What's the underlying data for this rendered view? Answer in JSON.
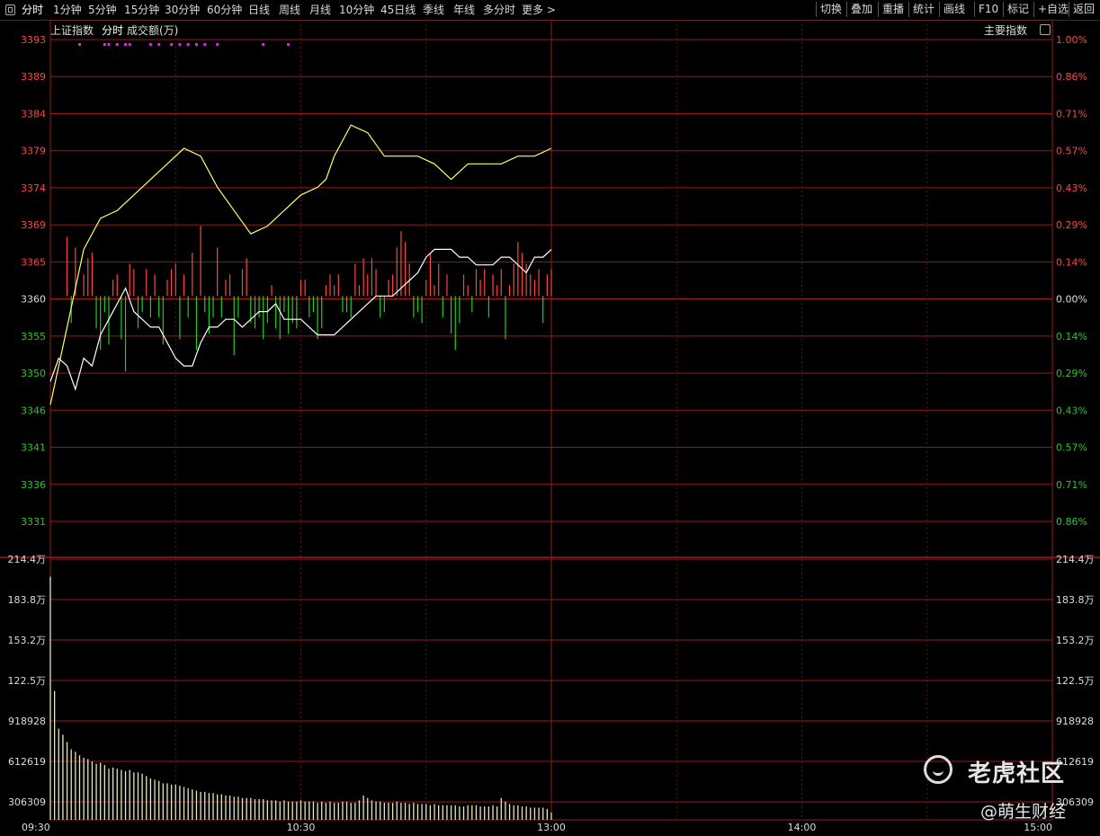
{
  "toolbar": {
    "left_items": [
      "分时",
      "1分钟",
      "5分钟",
      "15分钟",
      "30分钟",
      "60分钟",
      "日线",
      "周线",
      "月线",
      "10分钟",
      "45日线",
      "季线",
      "年线",
      "多分时",
      "更多 >"
    ],
    "right_items": [
      "切换",
      "叠加",
      "重播",
      "统计",
      "画线",
      "F10",
      "标记",
      "+自选",
      "返回"
    ],
    "active": "分时"
  },
  "header": {
    "index_name": "上证指数",
    "mode": "分时",
    "indicator": "成交额(万)",
    "right_label": "主要指数"
  },
  "colors": {
    "background": "#000000",
    "grid": "#9a1a1a",
    "up": "#ff4444",
    "down": "#22cc22",
    "price_line": "#ffffff",
    "avg_line": "#ffff66",
    "volume_bar": "#e8e8c0",
    "marker": "#cc33cc"
  },
  "chart_data": [
    {
      "type": "line",
      "title": "上证指数 分时",
      "y_ticks_left": [
        "3393",
        "3389",
        "3384",
        "3379",
        "3374",
        "3369",
        "3365",
        "3360",
        "3355",
        "3350",
        "3346",
        "3341",
        "3336",
        "3331"
      ],
      "y_ticks_right": [
        "1.00%",
        "0.86%",
        "0.71%",
        "0.57%",
        "0.43%",
        "0.29%",
        "0.14%",
        "0.00%",
        "0.14%",
        "0.29%",
        "0.43%",
        "0.57%",
        "0.71%",
        "0.86%"
      ],
      "ylim": [
        3331,
        3393
      ],
      "baseline": 3360,
      "x_ticks": [
        "09:30",
        "10:30",
        "13:00",
        "14:00",
        "15:00"
      ],
      "x_range_minutes": [
        0,
        240
      ],
      "series": [
        {
          "name": "price",
          "x": [
            0,
            2,
            4,
            6,
            8,
            10,
            12,
            14,
            16,
            18,
            20,
            22,
            24,
            26,
            28,
            30,
            32,
            34,
            36,
            38,
            40,
            42,
            44,
            46,
            48,
            50,
            52,
            54,
            56,
            58,
            60,
            62,
            64,
            66,
            68,
            70,
            72,
            74,
            76,
            78,
            80,
            82,
            84,
            86,
            88,
            90,
            92,
            94,
            96,
            98,
            100,
            102,
            104,
            106,
            108,
            110,
            112,
            114,
            116,
            118,
            120
          ],
          "y": [
            3349,
            3352,
            3351,
            3348,
            3352,
            3351,
            3355,
            3357,
            3359,
            3361,
            3358,
            3357,
            3356,
            3356,
            3354,
            3352,
            3351,
            3351,
            3354,
            3356,
            3356,
            3357,
            3357,
            3356,
            3357,
            3358,
            3358,
            3359,
            3357,
            3357,
            3357,
            3356,
            3355,
            3355,
            3355,
            3356,
            3357,
            3358,
            3359,
            3360,
            3360,
            3360,
            3361,
            3362,
            3363,
            3365,
            3366,
            3366,
            3366,
            3365,
            3365,
            3364,
            3364,
            3364,
            3365,
            3365,
            3364,
            3363,
            3365,
            3365,
            3366
          ]
        },
        {
          "name": "average",
          "x": [
            0,
            4,
            8,
            12,
            16,
            20,
            24,
            28,
            32,
            36,
            40,
            44,
            48,
            52,
            56,
            60,
            64,
            66,
            68,
            72,
            76,
            80,
            84,
            88,
            92,
            96,
            100,
            104,
            108,
            112,
            116,
            120
          ],
          "y": [
            3346,
            3356,
            3366,
            3370,
            3371,
            3373,
            3375,
            3377,
            3379,
            3378,
            3374,
            3371,
            3368,
            3369,
            3371,
            3373,
            3374,
            3375,
            3378,
            3382,
            3381,
            3378,
            3378,
            3378,
            3377,
            3375,
            3377,
            3377,
            3377,
            3378,
            3378,
            3379
          ]
        }
      ],
      "minute_bars": {
        "x": [
          4,
          5,
          6,
          8,
          9,
          10,
          11,
          12,
          13,
          14,
          15,
          16,
          17,
          18,
          19,
          20,
          21,
          22,
          23,
          24,
          25,
          26,
          27,
          28,
          29,
          30,
          31,
          32,
          33,
          34,
          35,
          36,
          37,
          38,
          39,
          40,
          41,
          42,
          43,
          44,
          45,
          46,
          47,
          48,
          49,
          50,
          51,
          52,
          53,
          54,
          55,
          56,
          57,
          58,
          59,
          60,
          61,
          62,
          63,
          64,
          65,
          66,
          67,
          68,
          69,
          70,
          71,
          72,
          73,
          74,
          75,
          76,
          77,
          78,
          79,
          80,
          81,
          82,
          83,
          84,
          85,
          86,
          87,
          88,
          89,
          90,
          91,
          92,
          93,
          94,
          95,
          96,
          97,
          98,
          99,
          100,
          101,
          102,
          103,
          104,
          105,
          106,
          107,
          108,
          109,
          110,
          111,
          112,
          113,
          114,
          115,
          116,
          117,
          118,
          119,
          120
        ],
        "v": [
          11,
          -5,
          9,
          4,
          7,
          8,
          -6,
          -10,
          -3,
          -9,
          3,
          4,
          -8,
          -14,
          6,
          5,
          -6,
          -3,
          5,
          -4,
          4,
          -4,
          -9,
          3,
          5,
          6,
          -8,
          4,
          -4,
          8,
          -10,
          13,
          -3,
          -7,
          -4,
          9,
          -4,
          3,
          4,
          -11,
          -4,
          5,
          7,
          -5,
          -6,
          -4,
          -8,
          -5,
          2,
          -6,
          -8,
          -3,
          -7,
          -5,
          -6,
          3,
          3,
          -4,
          -3,
          -8,
          -6,
          2,
          4,
          2,
          4,
          -3,
          -3,
          -4,
          6,
          2,
          7,
          4,
          7,
          5,
          -4,
          -3,
          3,
          4,
          9,
          12,
          10,
          6,
          -4,
          -3,
          -5,
          3,
          8,
          2,
          6,
          -4,
          4,
          -7,
          -10,
          -5,
          4,
          2,
          -3,
          5,
          3,
          5,
          -4,
          4,
          2,
          5,
          -8,
          2,
          6,
          10,
          8,
          6,
          4,
          3,
          5,
          -5,
          4,
          5,
          6,
          4,
          6
        ]
      },
      "markers_x": [
        7,
        13,
        14,
        16,
        18,
        19,
        24,
        26,
        29,
        31,
        33,
        35,
        37,
        40,
        51,
        57
      ]
    },
    {
      "type": "bar",
      "title": "成交额(万)",
      "y_ticks": [
        "214.4万",
        "183.8万",
        "153.2万",
        "122.5万",
        "918928",
        "612619",
        "306309"
      ],
      "ylim": [
        0,
        2144000
      ],
      "x_range_minutes": [
        0,
        240
      ],
      "x": [
        0,
        1,
        2,
        3,
        4,
        5,
        6,
        7,
        8,
        9,
        10,
        11,
        12,
        13,
        14,
        15,
        16,
        17,
        18,
        19,
        20,
        21,
        22,
        23,
        24,
        25,
        26,
        27,
        28,
        29,
        30,
        31,
        32,
        33,
        34,
        35,
        36,
        37,
        38,
        39,
        40,
        41,
        42,
        43,
        44,
        45,
        46,
        47,
        48,
        49,
        50,
        51,
        52,
        53,
        54,
        55,
        56,
        57,
        58,
        59,
        60,
        61,
        62,
        63,
        64,
        65,
        66,
        67,
        68,
        69,
        70,
        71,
        72,
        73,
        74,
        75,
        76,
        77,
        78,
        79,
        80,
        81,
        82,
        83,
        84,
        85,
        86,
        87,
        88,
        89,
        90,
        91,
        92,
        93,
        94,
        95,
        96,
        97,
        98,
        99,
        100,
        101,
        102,
        103,
        104,
        105,
        106,
        107,
        108,
        109,
        110,
        111,
        112,
        113,
        114,
        115,
        116,
        117,
        118,
        119,
        120
      ],
      "values": [
        2000000,
        1060000,
        750000,
        700000,
        640000,
        580000,
        560000,
        530000,
        510000,
        500000,
        480000,
        460000,
        470000,
        450000,
        420000,
        430000,
        420000,
        410000,
        400000,
        410000,
        390000,
        390000,
        380000,
        360000,
        340000,
        330000,
        320000,
        300000,
        300000,
        290000,
        290000,
        280000,
        270000,
        260000,
        250000,
        240000,
        230000,
        230000,
        220000,
        220000,
        210000,
        210000,
        200000,
        200000,
        190000,
        190000,
        180000,
        180000,
        180000,
        170000,
        170000,
        170000,
        160000,
        160000,
        160000,
        150000,
        160000,
        150000,
        150000,
        150000,
        160000,
        150000,
        150000,
        150000,
        140000,
        150000,
        140000,
        150000,
        140000,
        140000,
        150000,
        150000,
        140000,
        140000,
        160000,
        200000,
        180000,
        160000,
        150000,
        150000,
        140000,
        140000,
        140000,
        150000,
        140000,
        140000,
        130000,
        140000,
        130000,
        130000,
        130000,
        120000,
        130000,
        120000,
        120000,
        120000,
        120000,
        120000,
        110000,
        110000,
        120000,
        120000,
        120000,
        110000,
        110000,
        110000,
        120000,
        110000,
        180000,
        150000,
        130000,
        120000,
        120000,
        110000,
        110000,
        100000,
        100000,
        100000,
        100000,
        90000,
        60000
      ]
    }
  ]
}
